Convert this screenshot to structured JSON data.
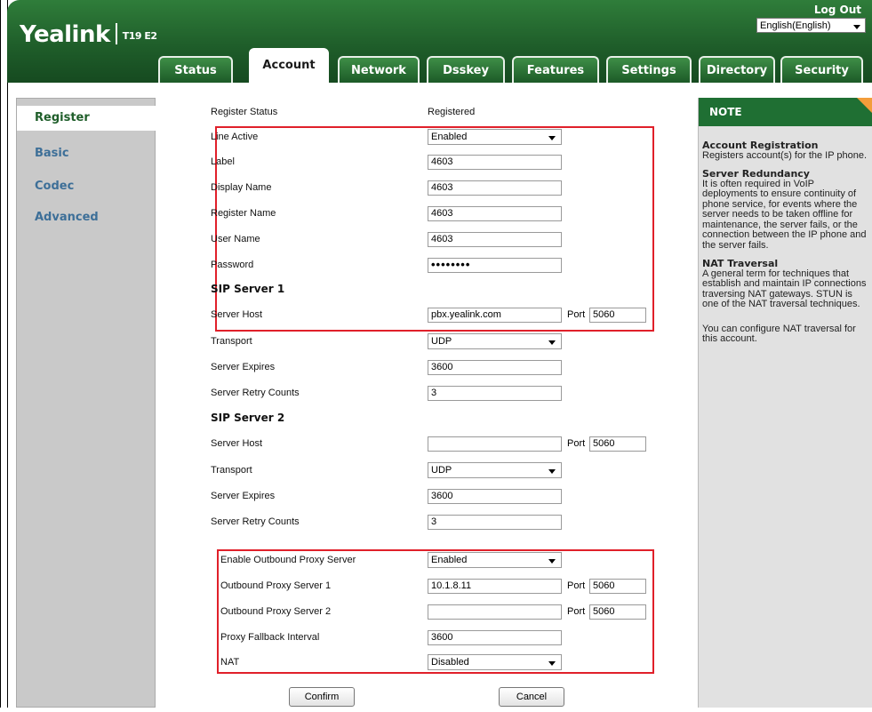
{
  "brand": {
    "logo": "Yealink",
    "model": "T19 E2"
  },
  "header": {
    "logout": "Log Out",
    "language": "English(English)"
  },
  "tabs": [
    {
      "label": "Status"
    },
    {
      "label": "Account"
    },
    {
      "label": "Network"
    },
    {
      "label": "Dsskey"
    },
    {
      "label": "Features"
    },
    {
      "label": "Settings"
    },
    {
      "label": "Directory"
    },
    {
      "label": "Security"
    }
  ],
  "sidebar": {
    "items": [
      {
        "label": "Register"
      },
      {
        "label": "Basic"
      },
      {
        "label": "Codec"
      },
      {
        "label": "Advanced"
      }
    ]
  },
  "form": {
    "register_status": {
      "label": "Register Status",
      "value": "Registered"
    },
    "line_active": {
      "label": "Line Active",
      "value": "Enabled"
    },
    "label": {
      "label": "Label",
      "value": "4603"
    },
    "display_name": {
      "label": "Display Name",
      "value": "4603"
    },
    "register_name": {
      "label": "Register Name",
      "value": "4603"
    },
    "user_name": {
      "label": "User Name",
      "value": "4603"
    },
    "password": {
      "label": "Password",
      "value": "••••••••"
    },
    "sip1": {
      "heading": "SIP Server 1",
      "host_label": "Server Host",
      "host": "pbx.yealink.com",
      "port_label": "Port",
      "port": "5060",
      "transport_label": "Transport",
      "transport": "UDP",
      "expires_label": "Server Expires",
      "expires": "3600",
      "retry_label": "Server Retry Counts",
      "retry": "3"
    },
    "sip2": {
      "heading": "SIP Server 2",
      "host_label": "Server Host",
      "host": "",
      "port_label": "Port",
      "port": "5060",
      "transport_label": "Transport",
      "transport": "UDP",
      "expires_label": "Server Expires",
      "expires": "3600",
      "retry_label": "Server Retry Counts",
      "retry": "3"
    },
    "outbound": {
      "enable_label": "Enable Outbound Proxy Server",
      "enable": "Enabled",
      "proxy1_label": "Outbound Proxy Server 1",
      "proxy1": "10.1.8.11",
      "proxy1_port": "5060",
      "proxy2_label": "Outbound Proxy Server 2",
      "proxy2": "",
      "proxy2_port": "5060",
      "port_label": "Port",
      "fallback_label": "Proxy Fallback Interval",
      "fallback": "3600",
      "nat_label": "NAT",
      "nat": "Disabled"
    },
    "buttons": {
      "confirm": "Confirm",
      "cancel": "Cancel"
    }
  },
  "note": {
    "title": "NOTE",
    "sections": [
      {
        "heading": "Account Registration",
        "text": "Registers account(s) for the IP phone."
      },
      {
        "heading": "Server Redundancy",
        "text": "It is often required in VoIP deployments to ensure continuity of phone service, for events where the server needs to be taken offline for maintenance, the server fails, or the connection between the IP phone and the server fails."
      },
      {
        "heading": "NAT Traversal",
        "text": "A general term for techniques that establish and maintain IP connections traversing NAT gateways. STUN is one of the NAT traversal techniques."
      },
      {
        "heading": "",
        "text": "You can configure NAT traversal for this account."
      }
    ]
  },
  "colors": {
    "header_green": "#1f5e2a",
    "note_flag": "#f39d3a",
    "highlight_red": "#e0202a",
    "nav_link": "#3d6f98"
  }
}
